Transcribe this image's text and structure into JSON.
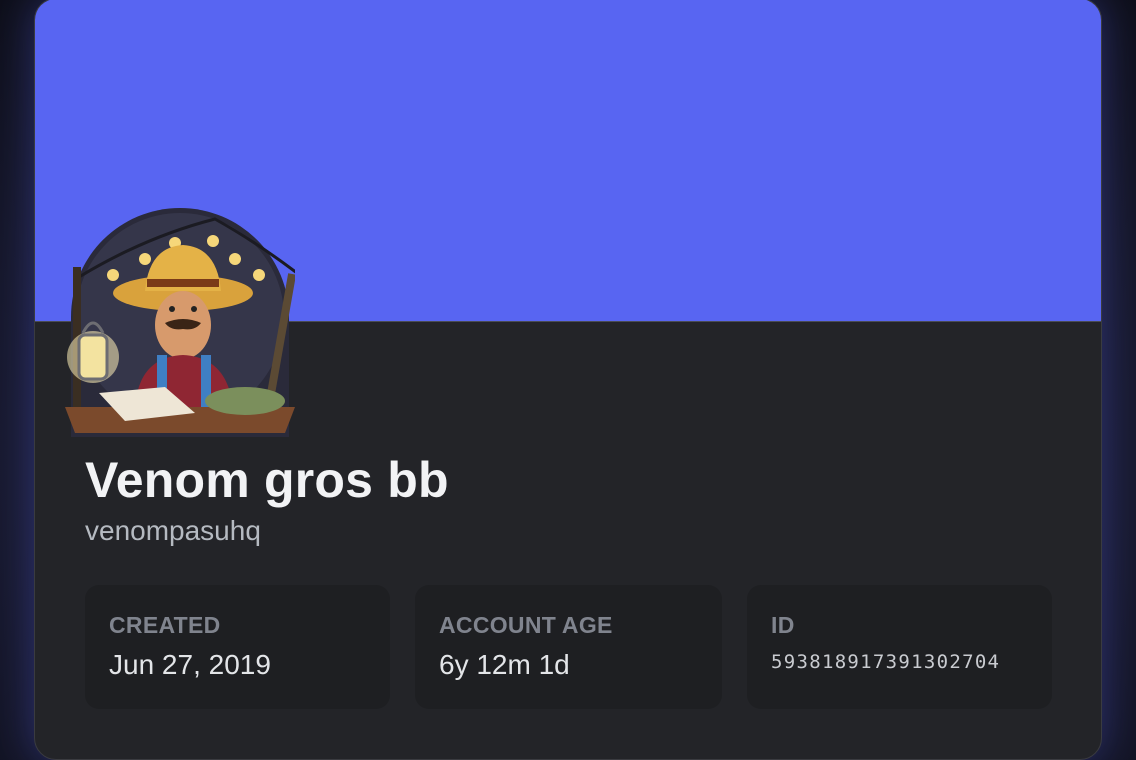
{
  "profile": {
    "display_name": "Venom gros bb",
    "username": "venompasuhq",
    "banner_color": "#5865f2",
    "avatar_icon": "avatar-farmer-with-lantern"
  },
  "stats": [
    {
      "label": "CREATED",
      "value": "Jun 27, 2019"
    },
    {
      "label": "ACCOUNT AGE",
      "value": "6y 12m 1d"
    },
    {
      "label": "ID",
      "value": "593818917391302704"
    }
  ]
}
